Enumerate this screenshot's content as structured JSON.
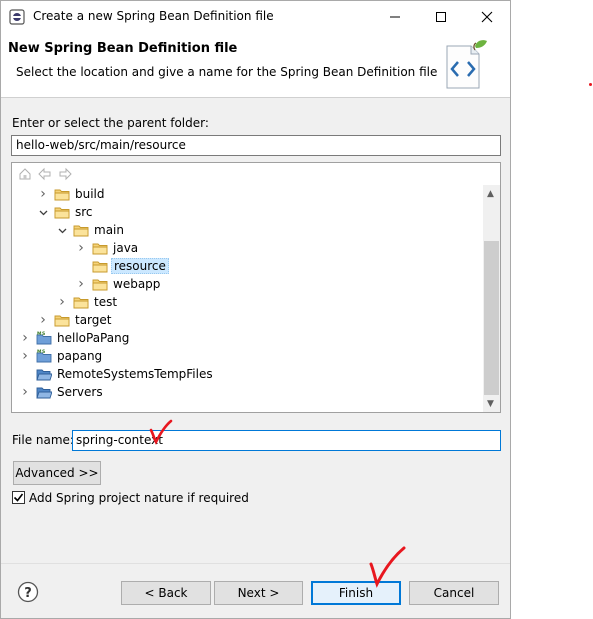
{
  "window": {
    "title": "Create a new Spring Bean Definition file",
    "controls": {
      "minimize": "minimize",
      "maximize": "maximize",
      "close": "close"
    }
  },
  "header": {
    "title": "New Spring Bean Definition file",
    "description": "Select the location and give a name for the Spring Bean Definition file"
  },
  "folder": {
    "label": "Enter or select the parent folder:",
    "value": "hello-web/src/main/resource"
  },
  "tree": {
    "items": [
      {
        "label": "build",
        "icon": "folder-icon",
        "expander": "collapsed"
      },
      {
        "label": "src",
        "icon": "folder-icon",
        "expander": "expanded"
      },
      {
        "label": "main",
        "icon": "folder-icon",
        "expander": "expanded"
      },
      {
        "label": "java",
        "icon": "folder-icon",
        "expander": "collapsed"
      },
      {
        "label": "resource",
        "icon": "folder-icon",
        "expander": "none",
        "selected": true
      },
      {
        "label": "webapp",
        "icon": "folder-icon",
        "expander": "collapsed"
      },
      {
        "label": "test",
        "icon": "folder-icon",
        "expander": "collapsed"
      },
      {
        "label": "target",
        "icon": "folder-icon",
        "expander": "collapsed"
      },
      {
        "label": "helloPaPang",
        "icon": "project-icon",
        "expander": "collapsed"
      },
      {
        "label": "papang",
        "icon": "project-icon",
        "expander": "collapsed"
      },
      {
        "label": "RemoteSystemsTempFiles",
        "icon": "open-project-icon",
        "expander": "none"
      },
      {
        "label": "Servers",
        "icon": "open-project-icon",
        "expander": "collapsed"
      }
    ]
  },
  "filename": {
    "label": "File name:",
    "value": "spring-context"
  },
  "advanced_label": "Advanced >>",
  "spring_nature": {
    "label": "Add Spring project nature if required",
    "checked": true
  },
  "buttons": {
    "back": "< Back",
    "next": "Next >",
    "finish": "Finish",
    "cancel": "Cancel"
  },
  "colors": {
    "accent": "#0078d7",
    "selection": "#cce8ff",
    "annotation": "#e8171f"
  }
}
